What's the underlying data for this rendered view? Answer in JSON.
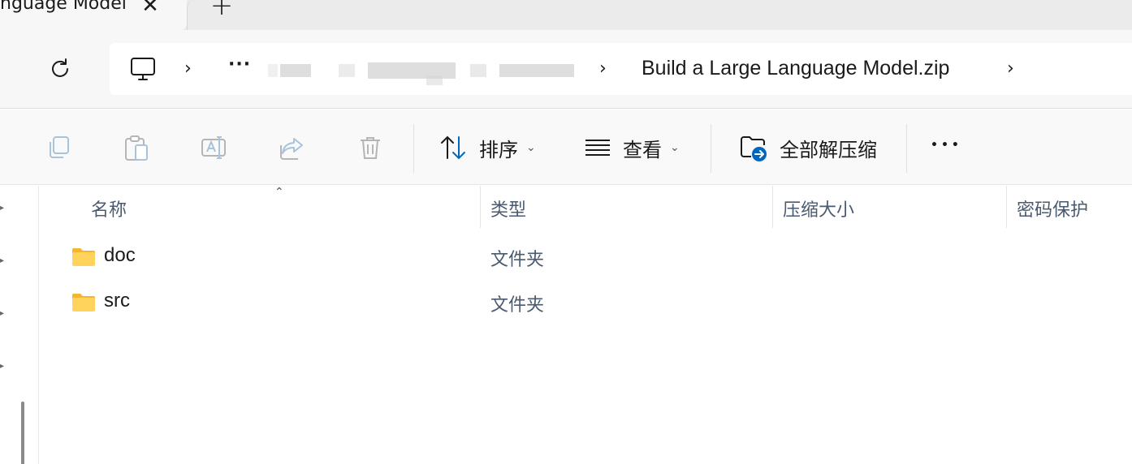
{
  "tab": {
    "title": "nguage Model",
    "close_glyph": "✕",
    "new_glyph": "+"
  },
  "address": {
    "chevron": "›",
    "ellipsis": "···",
    "zip_name": "Build a Large Language Model.zip"
  },
  "commands": {
    "sort_label": "排序",
    "view_label": "查看",
    "extract_all_label": "全部解压缩",
    "more_glyph": "•••",
    "caret": "⌄"
  },
  "columns": {
    "name": "名称",
    "type": "类型",
    "compressed_size": "压缩大小",
    "password": "密码保护",
    "sort_caret": "⌃"
  },
  "rows": [
    {
      "name": "doc",
      "type": "文件夹"
    },
    {
      "name": "src",
      "type": "文件夹"
    }
  ],
  "colors": {
    "accent": "#0067c0",
    "folder": "#ffd35c",
    "folder_dark": "#f2b631",
    "header_text": "#4a5a70"
  }
}
